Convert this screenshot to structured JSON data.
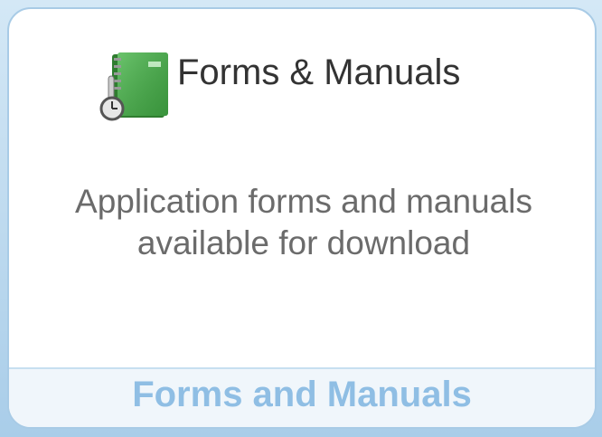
{
  "card": {
    "title": "Forms & Manuals",
    "icon": "book-clock-icon",
    "description": "Application forms and manuals available for download",
    "footer_link": "Forms and Manuals"
  },
  "colors": {
    "accent_link": "#8fbee4",
    "border": "#a8cbe6",
    "book_green": "#3d9a3d"
  }
}
